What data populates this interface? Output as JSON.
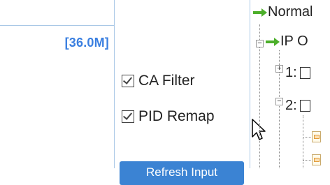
{
  "bitrate": {
    "value": "[36.0M]"
  },
  "filters": {
    "ca_filter_label": "CA Filter",
    "ca_filter_checked": true,
    "pid_remap_label": "PID Remap",
    "pid_remap_checked": true
  },
  "refresh_button": {
    "label": "Refresh Input"
  },
  "tree": {
    "normal_label": "Normal",
    "ip_node_label": "IP O",
    "node1_label": "1:",
    "node2_label": "2:"
  },
  "colors": {
    "accent_text": "#3a7fe0",
    "button_bg": "#3b83d3",
    "grid_line": "#a9c8e6",
    "arrow_green": "#4caf2a"
  },
  "icons": [
    "checkbox-checked-icon",
    "green-arrow-icon",
    "tree-expander-icon",
    "document-icon",
    "mouse-cursor-icon"
  ]
}
